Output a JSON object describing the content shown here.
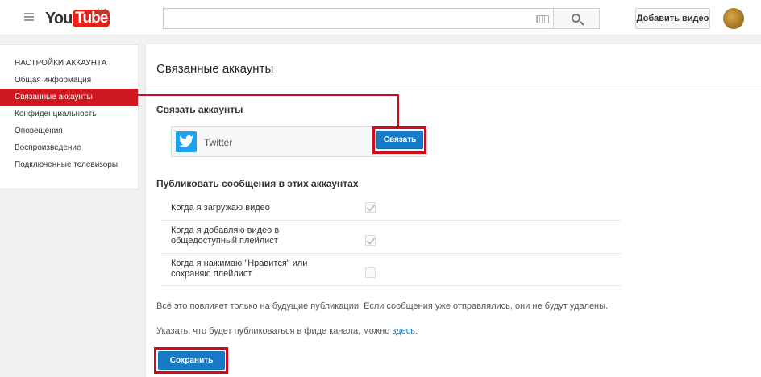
{
  "header": {
    "logo_you": "You",
    "logo_tube": "Tube",
    "logo_country": "UA",
    "search_placeholder": "",
    "upload_label": "Добавить видео"
  },
  "sidebar": {
    "title": "НАСТРОЙКИ АККАУНТА",
    "items": [
      {
        "label": "Общая информация",
        "active": false
      },
      {
        "label": "Связанные аккаунты",
        "active": true
      },
      {
        "label": "Конфиденциальность",
        "active": false
      },
      {
        "label": "Оповещения",
        "active": false
      },
      {
        "label": "Воспроизведение",
        "active": false
      },
      {
        "label": "Подключенные телевизоры",
        "active": false
      }
    ]
  },
  "main": {
    "page_title": "Связанные аккаунты",
    "connect_section_title": "Связать аккаунты",
    "service_name": "Twitter",
    "connect_label": "Связать",
    "publish_title": "Публиковать сообщения в этих аккаунтах",
    "options": [
      {
        "line1": "Когда я загружаю видео",
        "line2": "",
        "checked": true
      },
      {
        "line1": "Когда я добавляю видео в",
        "line2": "общедоступный плейлист",
        "checked": true
      },
      {
        "line1": "Когда я нажимаю \"Нравится\" или",
        "line2": "сохраняю плейлист",
        "checked": false
      }
    ],
    "note1": "Всё это повлияет только на будущие публикации. Если сообщения уже отправлялись, они не будут удалены.",
    "note2_prefix": "Указать, что будет публиковаться в фиде канала, можно ",
    "note2_link": "здесь",
    "note2_suffix": ".",
    "save_label": "Сохранить"
  },
  "colors": {
    "brand_red": "#e62117",
    "active_red": "#cc181e",
    "highlight_red": "#d20a1a",
    "button_blue": "#167ac6",
    "twitter_blue": "#1da1f2"
  }
}
